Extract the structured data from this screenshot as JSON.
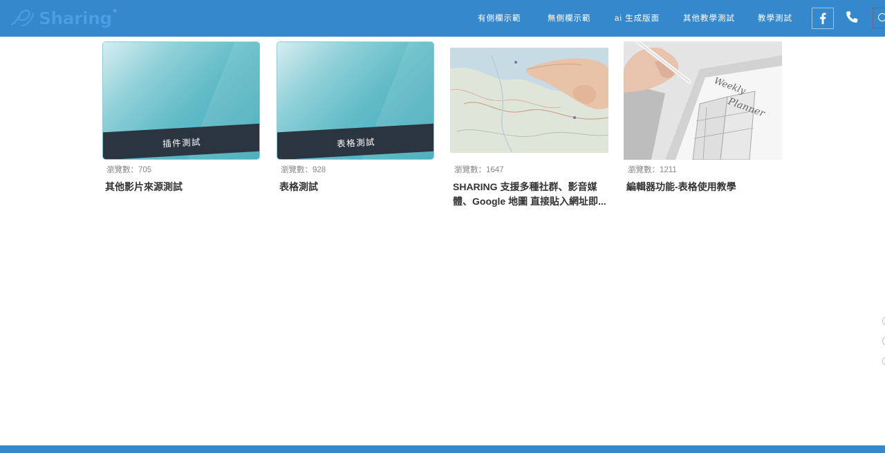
{
  "header": {
    "logo_text": "Sharing",
    "logo_reg": "®",
    "nav": [
      {
        "label": "有側欄示範"
      },
      {
        "label": "無側欄示範"
      },
      {
        "label": "ai 生成版面"
      },
      {
        "label": "其他教學測試"
      },
      {
        "label": "教學測試"
      }
    ],
    "icons": [
      "facebook-icon",
      "phone-icon",
      "search-icon"
    ],
    "bar_color": "#3688cc"
  },
  "cards": [
    {
      "thumb_label": "插件測試",
      "views": "瀏覽數：705",
      "title": "其他影片來源測試",
      "thumb_type": "teal-banner"
    },
    {
      "thumb_label": "表格測試",
      "views": "瀏覽數：928",
      "title": "表格測試",
      "thumb_type": "teal-banner"
    },
    {
      "views": "瀏覽數：1647",
      "title": "SHARING 支援多種社群、影音媒體、Google 地圖 直接貼入網址即...",
      "thumb_type": "map-photo"
    },
    {
      "views": "瀏覽數：1211",
      "title": "編輯器功能-表格使用教學",
      "thumb_type": "tablet-planner-photo"
    }
  ],
  "colors": {
    "accent": "#3688cc",
    "banner": "#2b3540",
    "teal": "#3da6b6",
    "views": "#888888",
    "title": "#333333"
  }
}
